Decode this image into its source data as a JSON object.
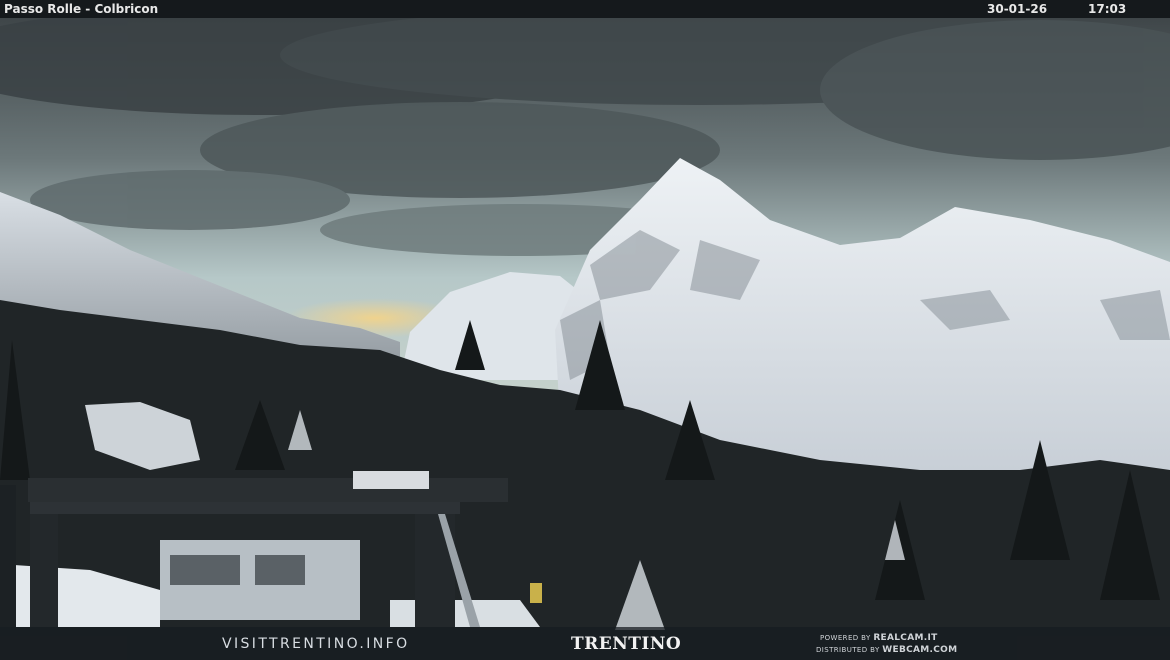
{
  "overlay": {
    "location": "Passo Rolle - Colbricon",
    "date": "30-01-26",
    "time": "17:03"
  },
  "footer": {
    "site": "VISITTRENTINO.INFO",
    "brand": "TRENTINO",
    "powered_label": "POWERED BY",
    "powered_name": "REALCAM.IT",
    "distributed_label": "DISTRIBUTED BY",
    "distributed_name": "WEBCAM.COM"
  },
  "colors": {
    "sky_dark": "#3c4448",
    "sky_light": "#b9cccc",
    "horizon_glow": "#e8d6a0",
    "snow": "#e4e9ee",
    "forest": "#1c2022"
  }
}
